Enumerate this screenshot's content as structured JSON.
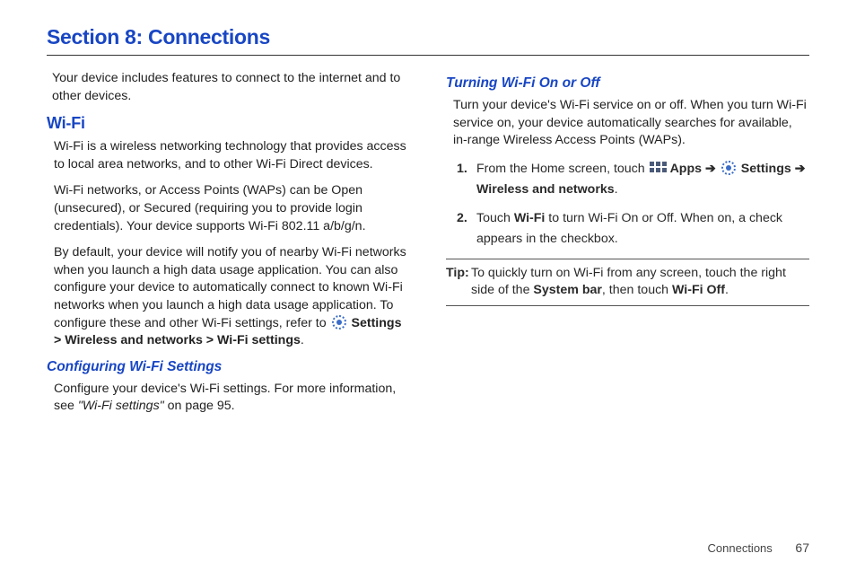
{
  "title": "Section 8: Connections",
  "intro": "Your device includes features to connect to the internet and to other devices.",
  "wifi": {
    "heading": "Wi-Fi",
    "p1": "Wi-Fi is a wireless networking technology that provides access to local area networks, and to other Wi-Fi Direct devices.",
    "p2": "Wi-Fi networks, or Access Points (WAPs) can be Open (unsecured), or Secured (requiring you to provide login credentials). Your device supports Wi-Fi 802.11 a/b/g/n.",
    "p3_a": "By default, your device will notify you of nearby Wi-Fi networks when you launch a high data usage application. You can also configure your device to automatically connect to known Wi-Fi networks when you launch a high data usage application. To configure these and other Wi-Fi settings, refer to ",
    "p3_b": "Settings > Wireless and networks > Wi-Fi settings",
    "p3_c": "."
  },
  "configuring": {
    "heading": "Configuring Wi-Fi Settings",
    "p_a": "Configure your device's Wi-Fi settings. For more information, see ",
    "p_ref": "\"Wi-Fi settings\"",
    "p_b": " on page 95."
  },
  "turning": {
    "heading": "Turning Wi-Fi On or Off",
    "p1": "Turn your device's Wi-Fi service on or off. When you turn Wi-Fi service on, your device automatically searches for available, in-range Wireless Access Points (WAPs).",
    "step1_a": "From the Home screen, touch ",
    "step1_apps": "Apps",
    "step1_arrow": " ➔ ",
    "step1_settings": "Settings",
    "step1_arrow2": " ➔ ",
    "step1_wireless": "Wireless and networks",
    "step1_end": ".",
    "step2_a": "Touch ",
    "step2_wifi": "Wi-Fi",
    "step2_b": " to turn Wi-Fi On or Off. When on, a check appears in the checkbox."
  },
  "tip": {
    "label": "Tip:",
    "a": " To quickly turn on Wi-Fi from any screen, touch the right side of the ",
    "b": "System bar",
    "c": ", then touch ",
    "d": "Wi-Fi Off",
    "e": "."
  },
  "footer": {
    "section": "Connections",
    "page": "67"
  }
}
